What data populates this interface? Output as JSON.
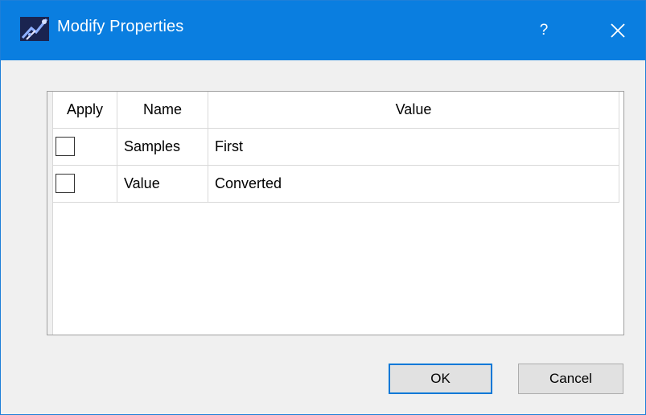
{
  "window": {
    "title": "Modify Properties",
    "help_label": "?",
    "title_bar_color": "#0a7ee0"
  },
  "icons": {
    "app": "app-icon",
    "help": "help-icon",
    "close": "close-icon"
  },
  "table": {
    "columns": [
      "Apply",
      "Name",
      "Value"
    ],
    "rows": [
      {
        "apply": false,
        "name": "Samples",
        "value": "First"
      },
      {
        "apply": false,
        "name": "Value",
        "value": "Converted"
      }
    ]
  },
  "buttons": {
    "ok": "OK",
    "cancel": "Cancel"
  }
}
